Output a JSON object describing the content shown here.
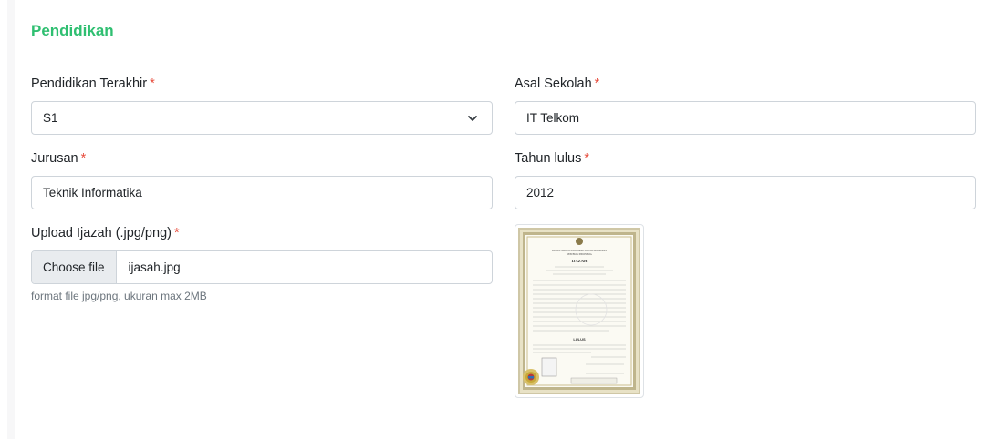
{
  "section": {
    "title": "Pendidikan"
  },
  "fields": {
    "pendidikan_terakhir": {
      "label": "Pendidikan Terakhir",
      "required_mark": "*",
      "value": "S1"
    },
    "asal_sekolah": {
      "label": "Asal Sekolah",
      "required_mark": "*",
      "value": "IT Telkom"
    },
    "jurusan": {
      "label": "Jurusan",
      "required_mark": "*",
      "value": "Teknik Informatika"
    },
    "tahun_lulus": {
      "label": "Tahun lulus",
      "required_mark": "*",
      "value": "2012"
    },
    "ijazah": {
      "label": "Upload Ijazah (.jpg/png)",
      "required_mark": "*",
      "button_label": "Choose file",
      "file_name": "ijasah.jpg",
      "hint": "format file jpg/png, ukuran max 2MB"
    }
  },
  "preview": {
    "header_lines": [
      "KEMENTERIAN PENDIDIKAN DAN KEBUDAYAAN",
      "REPUBLIK INDONESIA"
    ],
    "title": "IJAZAH",
    "status": "LULUS"
  },
  "colors": {
    "accent": "#2fbf71",
    "required": "#e74c3c",
    "hint": "#6c757d"
  }
}
